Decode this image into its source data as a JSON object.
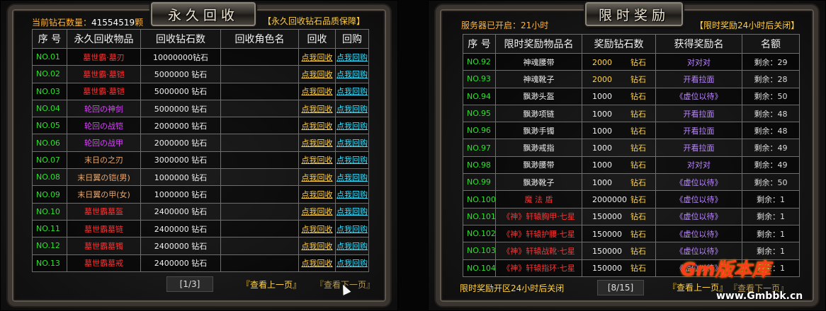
{
  "left": {
    "title": "永久回收",
    "diamond_label": "当前钻石数量：",
    "diamond_value": "41554519",
    "diamond_unit": "颗",
    "guarantee": "【永久回收钻石品质保障】",
    "headers": [
      "序 号",
      "永久回收物品",
      "回收钻石数",
      "回收角色名",
      "回收",
      "回购"
    ],
    "rows": [
      {
        "no": "NO.01",
        "item": "墓世霸·墓刃",
        "color": "red",
        "diamonds": "10000000钻石",
        "recycle": "点我回收",
        "buyback": "点我回购"
      },
      {
        "no": "NO.02",
        "item": "墓世霸·墓铠",
        "color": "red",
        "diamonds": "5000000 钻石",
        "recycle": "点我回收",
        "buyback": "点我回购"
      },
      {
        "no": "NO.03",
        "item": "墓世霸·墓铠",
        "color": "red",
        "diamonds": "5000000 钻石",
        "recycle": "点我回收",
        "buyback": "点我回购"
      },
      {
        "no": "NO.04",
        "item": "轮回の神剑",
        "color": "purple",
        "diamonds": "5000000 钻石",
        "recycle": "点我回收",
        "buyback": "点我回购"
      },
      {
        "no": "NO.05",
        "item": "轮回の战铠",
        "color": "purple",
        "diamonds": "2000000 钻石",
        "recycle": "点我回收",
        "buyback": "点我回购"
      },
      {
        "no": "NO.06",
        "item": "轮回の战甲",
        "color": "purple",
        "diamonds": "2000000 钻石",
        "recycle": "点我回收",
        "buyback": "点我回购"
      },
      {
        "no": "NO.07",
        "item": "末日の之刃",
        "color": "orange",
        "diamonds": "3000000 钻石",
        "recycle": "点我回收",
        "buyback": "点我回购"
      },
      {
        "no": "NO.08",
        "item": "末日翼の铠(男)",
        "color": "orange",
        "diamonds": "1000000 钻石",
        "recycle": "点我回收",
        "buyback": "点我回购"
      },
      {
        "no": "NO.09",
        "item": "末日翼の甲(女)",
        "color": "orange",
        "diamonds": "1000000 钻石",
        "recycle": "点我回收",
        "buyback": "点我回购"
      },
      {
        "no": "NO.10",
        "item": "墓世霸墓盔",
        "color": "red",
        "diamonds": "2400000 钻石",
        "recycle": "点我回收",
        "buyback": "点我回购"
      },
      {
        "no": "NO.11",
        "item": "墓世霸墓链",
        "color": "red",
        "diamonds": "2400000 钻石",
        "recycle": "点我回收",
        "buyback": "点我回购"
      },
      {
        "no": "NO.12",
        "item": "墓世霸墓镯",
        "color": "red",
        "diamonds": "2400000 钻石",
        "recycle": "点我回收",
        "buyback": "点我回购"
      },
      {
        "no": "NO.13",
        "item": "墓世霸墓戒",
        "color": "red",
        "diamonds": "2400000 钻石",
        "recycle": "点我回收",
        "buyback": "点我回购"
      }
    ],
    "page": "[1/3]",
    "prev": "『查看上一页』",
    "next": "『查看下一页』"
  },
  "right": {
    "title": "限时奖励",
    "server_label": "服务器已开启：",
    "server_value": "21",
    "server_unit": "小时",
    "close_note": "【限时奖励24小时后关闭】",
    "headers": [
      "序 号",
      "限时奖励物品名",
      "奖励钻石数",
      "获得奖励名",
      "名额"
    ],
    "rows": [
      {
        "no": "NO.92",
        "item": "神魂腰带",
        "icolor": "white",
        "amount": "2000",
        "amt_color": "yellow",
        "unit": "钻石",
        "reward": "对对对",
        "rcolor": "violet",
        "quota": "剩余：29"
      },
      {
        "no": "NO.93",
        "item": "神魂靴子",
        "icolor": "white",
        "amount": "2000",
        "amt_color": "yellow",
        "unit": "钻石",
        "reward": "开看拉面",
        "rcolor": "violet",
        "quota": "剩余：28"
      },
      {
        "no": "NO.94",
        "item": "飘渺头盔",
        "icolor": "white",
        "amount": "1000",
        "amt_color": "white",
        "unit": "钻石",
        "reward": "《虚位以待》",
        "rcolor": "violet",
        "quota": "剩余：50"
      },
      {
        "no": "NO.95",
        "item": "飘渺项链",
        "icolor": "white",
        "amount": "1000",
        "amt_color": "white",
        "unit": "钻石",
        "reward": "开看拉面",
        "rcolor": "violet",
        "quota": "剩余：48"
      },
      {
        "no": "NO.96",
        "item": "飘渺手镯",
        "icolor": "white",
        "amount": "1000",
        "amt_color": "white",
        "unit": "钻石",
        "reward": "开看拉面",
        "rcolor": "violet",
        "quota": "剩余：48"
      },
      {
        "no": "NO.97",
        "item": "飘渺戒指",
        "icolor": "white",
        "amount": "1000",
        "amt_color": "white",
        "unit": "钻石",
        "reward": "开看拉面",
        "rcolor": "violet",
        "quota": "剩余：49"
      },
      {
        "no": "NO.98",
        "item": "飘渺腰带",
        "icolor": "white",
        "amount": "1000",
        "amt_color": "white",
        "unit": "钻石",
        "reward": "对对对",
        "rcolor": "violet",
        "quota": "剩余：49"
      },
      {
        "no": "NO.99",
        "item": "飘渺靴子",
        "icolor": "white",
        "amount": "1000",
        "amt_color": "white",
        "unit": "钻石",
        "reward": "《虚位以待》",
        "rcolor": "violet",
        "quota": "剩余：50"
      },
      {
        "no": "NO.100",
        "item": "魔 法 盾",
        "icolor": "red",
        "amount": "2000000",
        "amt_color": "white",
        "unit": "钻石",
        "reward": "《虚位以待》",
        "rcolor": "violet",
        "quota": "剩余：1"
      },
      {
        "no": "NO.101",
        "item": "《神》轩辕胸甲·七星",
        "icolor": "red",
        "amount": "150000",
        "amt_color": "white",
        "unit": "钻石",
        "reward": "《虚位以待》",
        "rcolor": "violet",
        "quota": "剩余：1"
      },
      {
        "no": "NO.102",
        "item": "《神》轩辕护腰·七星",
        "icolor": "red",
        "amount": "150000",
        "amt_color": "white",
        "unit": "钻石",
        "reward": "《虚位以待》",
        "rcolor": "violet",
        "quota": "剩余：1"
      },
      {
        "no": "NO.103",
        "item": "《神》轩辕战靴·七星",
        "icolor": "red",
        "amount": "150000",
        "amt_color": "white",
        "unit": "钻石",
        "reward": "《虚位以待》",
        "rcolor": "violet",
        "quota": "剩余：1"
      },
      {
        "no": "NO.104",
        "item": "《神》轩辕指环·七星",
        "icolor": "red",
        "amount": "150000",
        "amt_color": "white",
        "unit": "钻石",
        "reward": "《虚位以待》",
        "rcolor": "violet",
        "quota": "剩余：1"
      }
    ],
    "footer_note": "限时奖励开区24小时后关闭",
    "page": "[8/15]",
    "prev": "『查看上一页』",
    "next": "『查看下一页』"
  },
  "watermark": {
    "logo": "Gm版本库",
    "url": "www.Gmbbk.cn"
  }
}
